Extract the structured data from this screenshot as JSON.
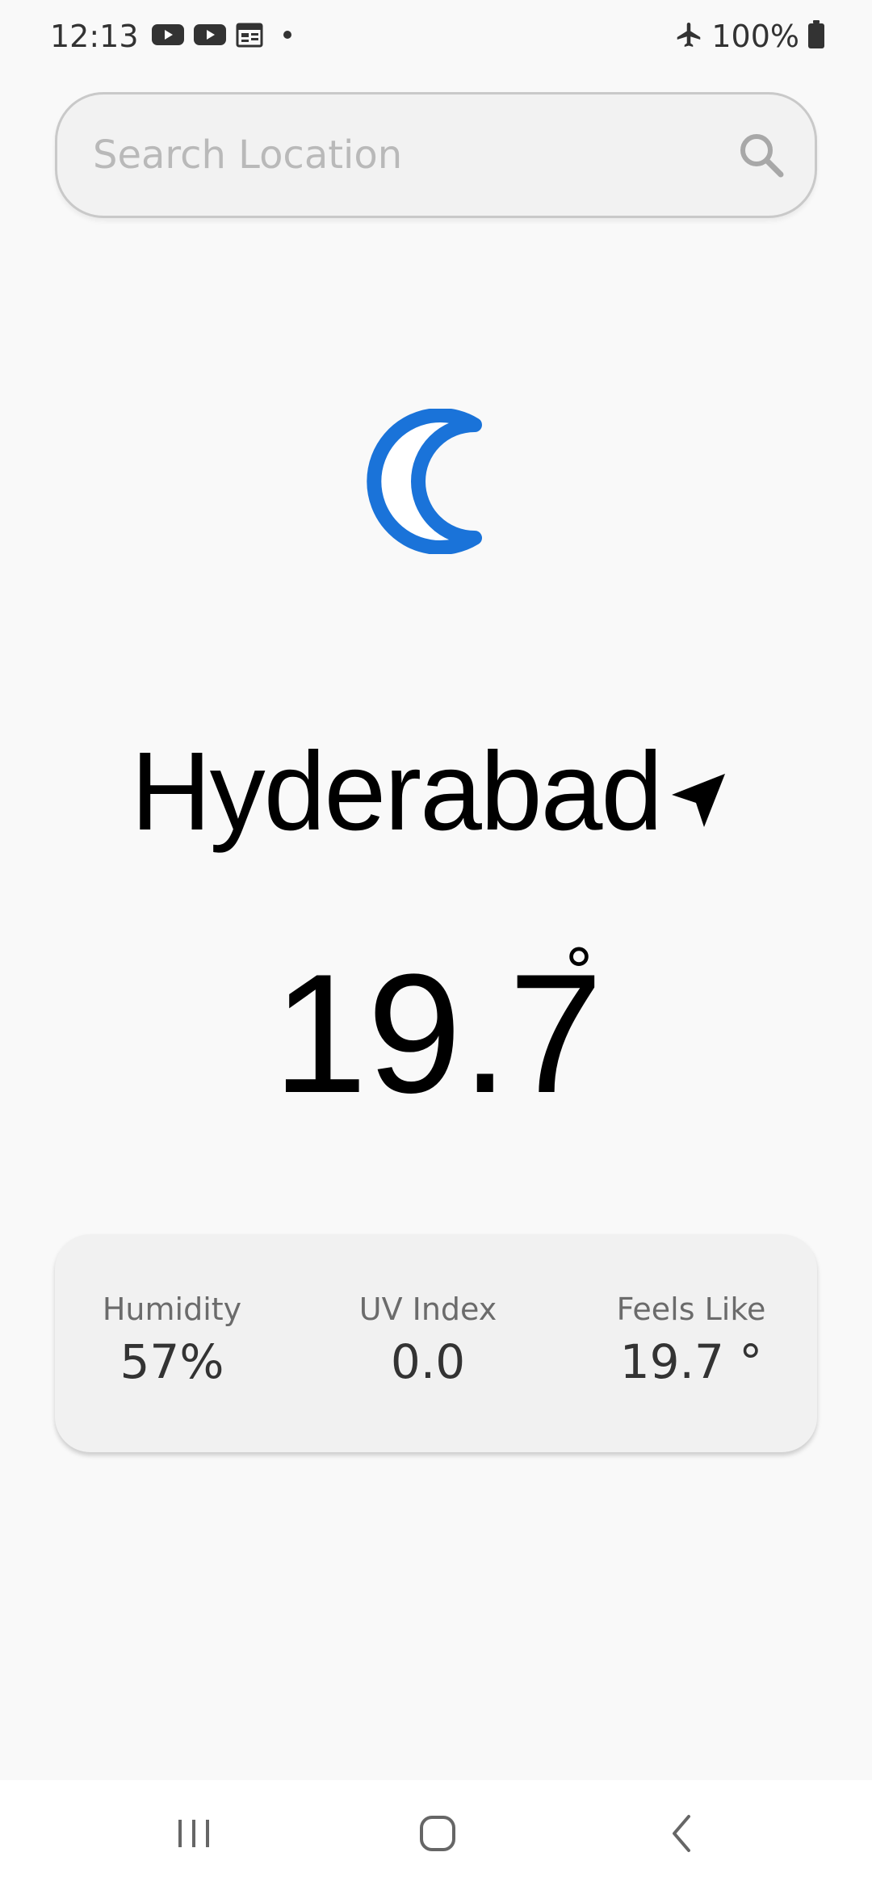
{
  "status_bar": {
    "time": "12:13",
    "battery": "100%",
    "icons": [
      "youtube-icon",
      "youtube-icon",
      "calendar-icon",
      "notification-dot-icon",
      "airplane-mode-icon",
      "battery-icon"
    ]
  },
  "search": {
    "placeholder": "Search Location",
    "value": ""
  },
  "weather": {
    "condition_icon": "moon-icon",
    "icon_color": "#1a73d9",
    "city": "Hyderabad",
    "temperature": "19.7",
    "degree_symbol": "°"
  },
  "stats": [
    {
      "label": "Humidity",
      "value": "57%"
    },
    {
      "label": "UV Index",
      "value": "0.0"
    },
    {
      "label": "Feels Like",
      "value": "19.7 °"
    }
  ],
  "nav": {
    "icons": [
      "recents-icon",
      "home-icon",
      "back-icon"
    ]
  }
}
